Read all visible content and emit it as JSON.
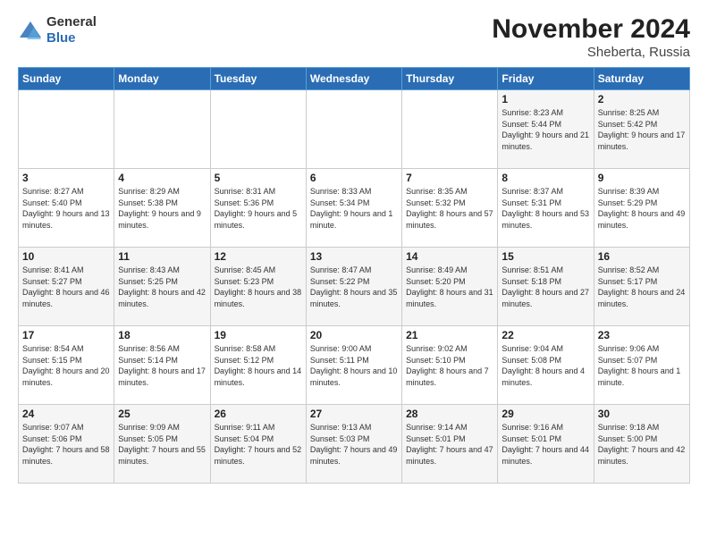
{
  "header": {
    "logo_line1": "General",
    "logo_line2": "Blue",
    "month": "November 2024",
    "location": "Sheberta, Russia"
  },
  "weekdays": [
    "Sunday",
    "Monday",
    "Tuesday",
    "Wednesday",
    "Thursday",
    "Friday",
    "Saturday"
  ],
  "weeks": [
    [
      {
        "day": "",
        "info": ""
      },
      {
        "day": "",
        "info": ""
      },
      {
        "day": "",
        "info": ""
      },
      {
        "day": "",
        "info": ""
      },
      {
        "day": "",
        "info": ""
      },
      {
        "day": "1",
        "info": "Sunrise: 8:23 AM\nSunset: 5:44 PM\nDaylight: 9 hours and 21 minutes."
      },
      {
        "day": "2",
        "info": "Sunrise: 8:25 AM\nSunset: 5:42 PM\nDaylight: 9 hours and 17 minutes."
      }
    ],
    [
      {
        "day": "3",
        "info": "Sunrise: 8:27 AM\nSunset: 5:40 PM\nDaylight: 9 hours and 13 minutes."
      },
      {
        "day": "4",
        "info": "Sunrise: 8:29 AM\nSunset: 5:38 PM\nDaylight: 9 hours and 9 minutes."
      },
      {
        "day": "5",
        "info": "Sunrise: 8:31 AM\nSunset: 5:36 PM\nDaylight: 9 hours and 5 minutes."
      },
      {
        "day": "6",
        "info": "Sunrise: 8:33 AM\nSunset: 5:34 PM\nDaylight: 9 hours and 1 minute."
      },
      {
        "day": "7",
        "info": "Sunrise: 8:35 AM\nSunset: 5:32 PM\nDaylight: 8 hours and 57 minutes."
      },
      {
        "day": "8",
        "info": "Sunrise: 8:37 AM\nSunset: 5:31 PM\nDaylight: 8 hours and 53 minutes."
      },
      {
        "day": "9",
        "info": "Sunrise: 8:39 AM\nSunset: 5:29 PM\nDaylight: 8 hours and 49 minutes."
      }
    ],
    [
      {
        "day": "10",
        "info": "Sunrise: 8:41 AM\nSunset: 5:27 PM\nDaylight: 8 hours and 46 minutes."
      },
      {
        "day": "11",
        "info": "Sunrise: 8:43 AM\nSunset: 5:25 PM\nDaylight: 8 hours and 42 minutes."
      },
      {
        "day": "12",
        "info": "Sunrise: 8:45 AM\nSunset: 5:23 PM\nDaylight: 8 hours and 38 minutes."
      },
      {
        "day": "13",
        "info": "Sunrise: 8:47 AM\nSunset: 5:22 PM\nDaylight: 8 hours and 35 minutes."
      },
      {
        "day": "14",
        "info": "Sunrise: 8:49 AM\nSunset: 5:20 PM\nDaylight: 8 hours and 31 minutes."
      },
      {
        "day": "15",
        "info": "Sunrise: 8:51 AM\nSunset: 5:18 PM\nDaylight: 8 hours and 27 minutes."
      },
      {
        "day": "16",
        "info": "Sunrise: 8:52 AM\nSunset: 5:17 PM\nDaylight: 8 hours and 24 minutes."
      }
    ],
    [
      {
        "day": "17",
        "info": "Sunrise: 8:54 AM\nSunset: 5:15 PM\nDaylight: 8 hours and 20 minutes."
      },
      {
        "day": "18",
        "info": "Sunrise: 8:56 AM\nSunset: 5:14 PM\nDaylight: 8 hours and 17 minutes."
      },
      {
        "day": "19",
        "info": "Sunrise: 8:58 AM\nSunset: 5:12 PM\nDaylight: 8 hours and 14 minutes."
      },
      {
        "day": "20",
        "info": "Sunrise: 9:00 AM\nSunset: 5:11 PM\nDaylight: 8 hours and 10 minutes."
      },
      {
        "day": "21",
        "info": "Sunrise: 9:02 AM\nSunset: 5:10 PM\nDaylight: 8 hours and 7 minutes."
      },
      {
        "day": "22",
        "info": "Sunrise: 9:04 AM\nSunset: 5:08 PM\nDaylight: 8 hours and 4 minutes."
      },
      {
        "day": "23",
        "info": "Sunrise: 9:06 AM\nSunset: 5:07 PM\nDaylight: 8 hours and 1 minute."
      }
    ],
    [
      {
        "day": "24",
        "info": "Sunrise: 9:07 AM\nSunset: 5:06 PM\nDaylight: 7 hours and 58 minutes."
      },
      {
        "day": "25",
        "info": "Sunrise: 9:09 AM\nSunset: 5:05 PM\nDaylight: 7 hours and 55 minutes."
      },
      {
        "day": "26",
        "info": "Sunrise: 9:11 AM\nSunset: 5:04 PM\nDaylight: 7 hours and 52 minutes."
      },
      {
        "day": "27",
        "info": "Sunrise: 9:13 AM\nSunset: 5:03 PM\nDaylight: 7 hours and 49 minutes."
      },
      {
        "day": "28",
        "info": "Sunrise: 9:14 AM\nSunset: 5:01 PM\nDaylight: 7 hours and 47 minutes."
      },
      {
        "day": "29",
        "info": "Sunrise: 9:16 AM\nSunset: 5:01 PM\nDaylight: 7 hours and 44 minutes."
      },
      {
        "day": "30",
        "info": "Sunrise: 9:18 AM\nSunset: 5:00 PM\nDaylight: 7 hours and 42 minutes."
      }
    ]
  ]
}
